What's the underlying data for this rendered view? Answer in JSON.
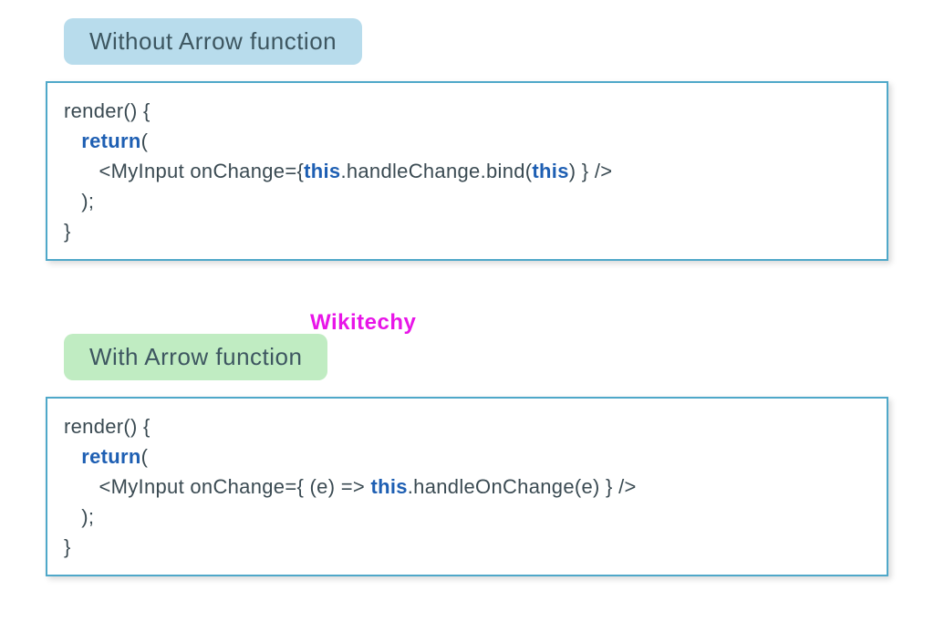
{
  "watermark": "Wikitechy",
  "section1": {
    "heading": "Without Arrow function",
    "code": {
      "l1": "render() {",
      "l2a": "   ",
      "l2b": "return",
      "l2c": "(",
      "l3a": "      <MyInput onChange={",
      "l3b": "this",
      "l3c": ".handleChange.bind(",
      "l3d": "this",
      "l3e": ") } />",
      "l4": "   );",
      "l5": "}"
    }
  },
  "section2": {
    "heading": "With Arrow function",
    "code": {
      "l1": "render() {",
      "l2a": "   ",
      "l2b": "return",
      "l2c": "(",
      "l3a": "      <MyInput onChange={ (e) => ",
      "l3b": "this",
      "l3c": ".handleOnChange(e) } />",
      "l4": "   );",
      "l5": "}"
    }
  }
}
